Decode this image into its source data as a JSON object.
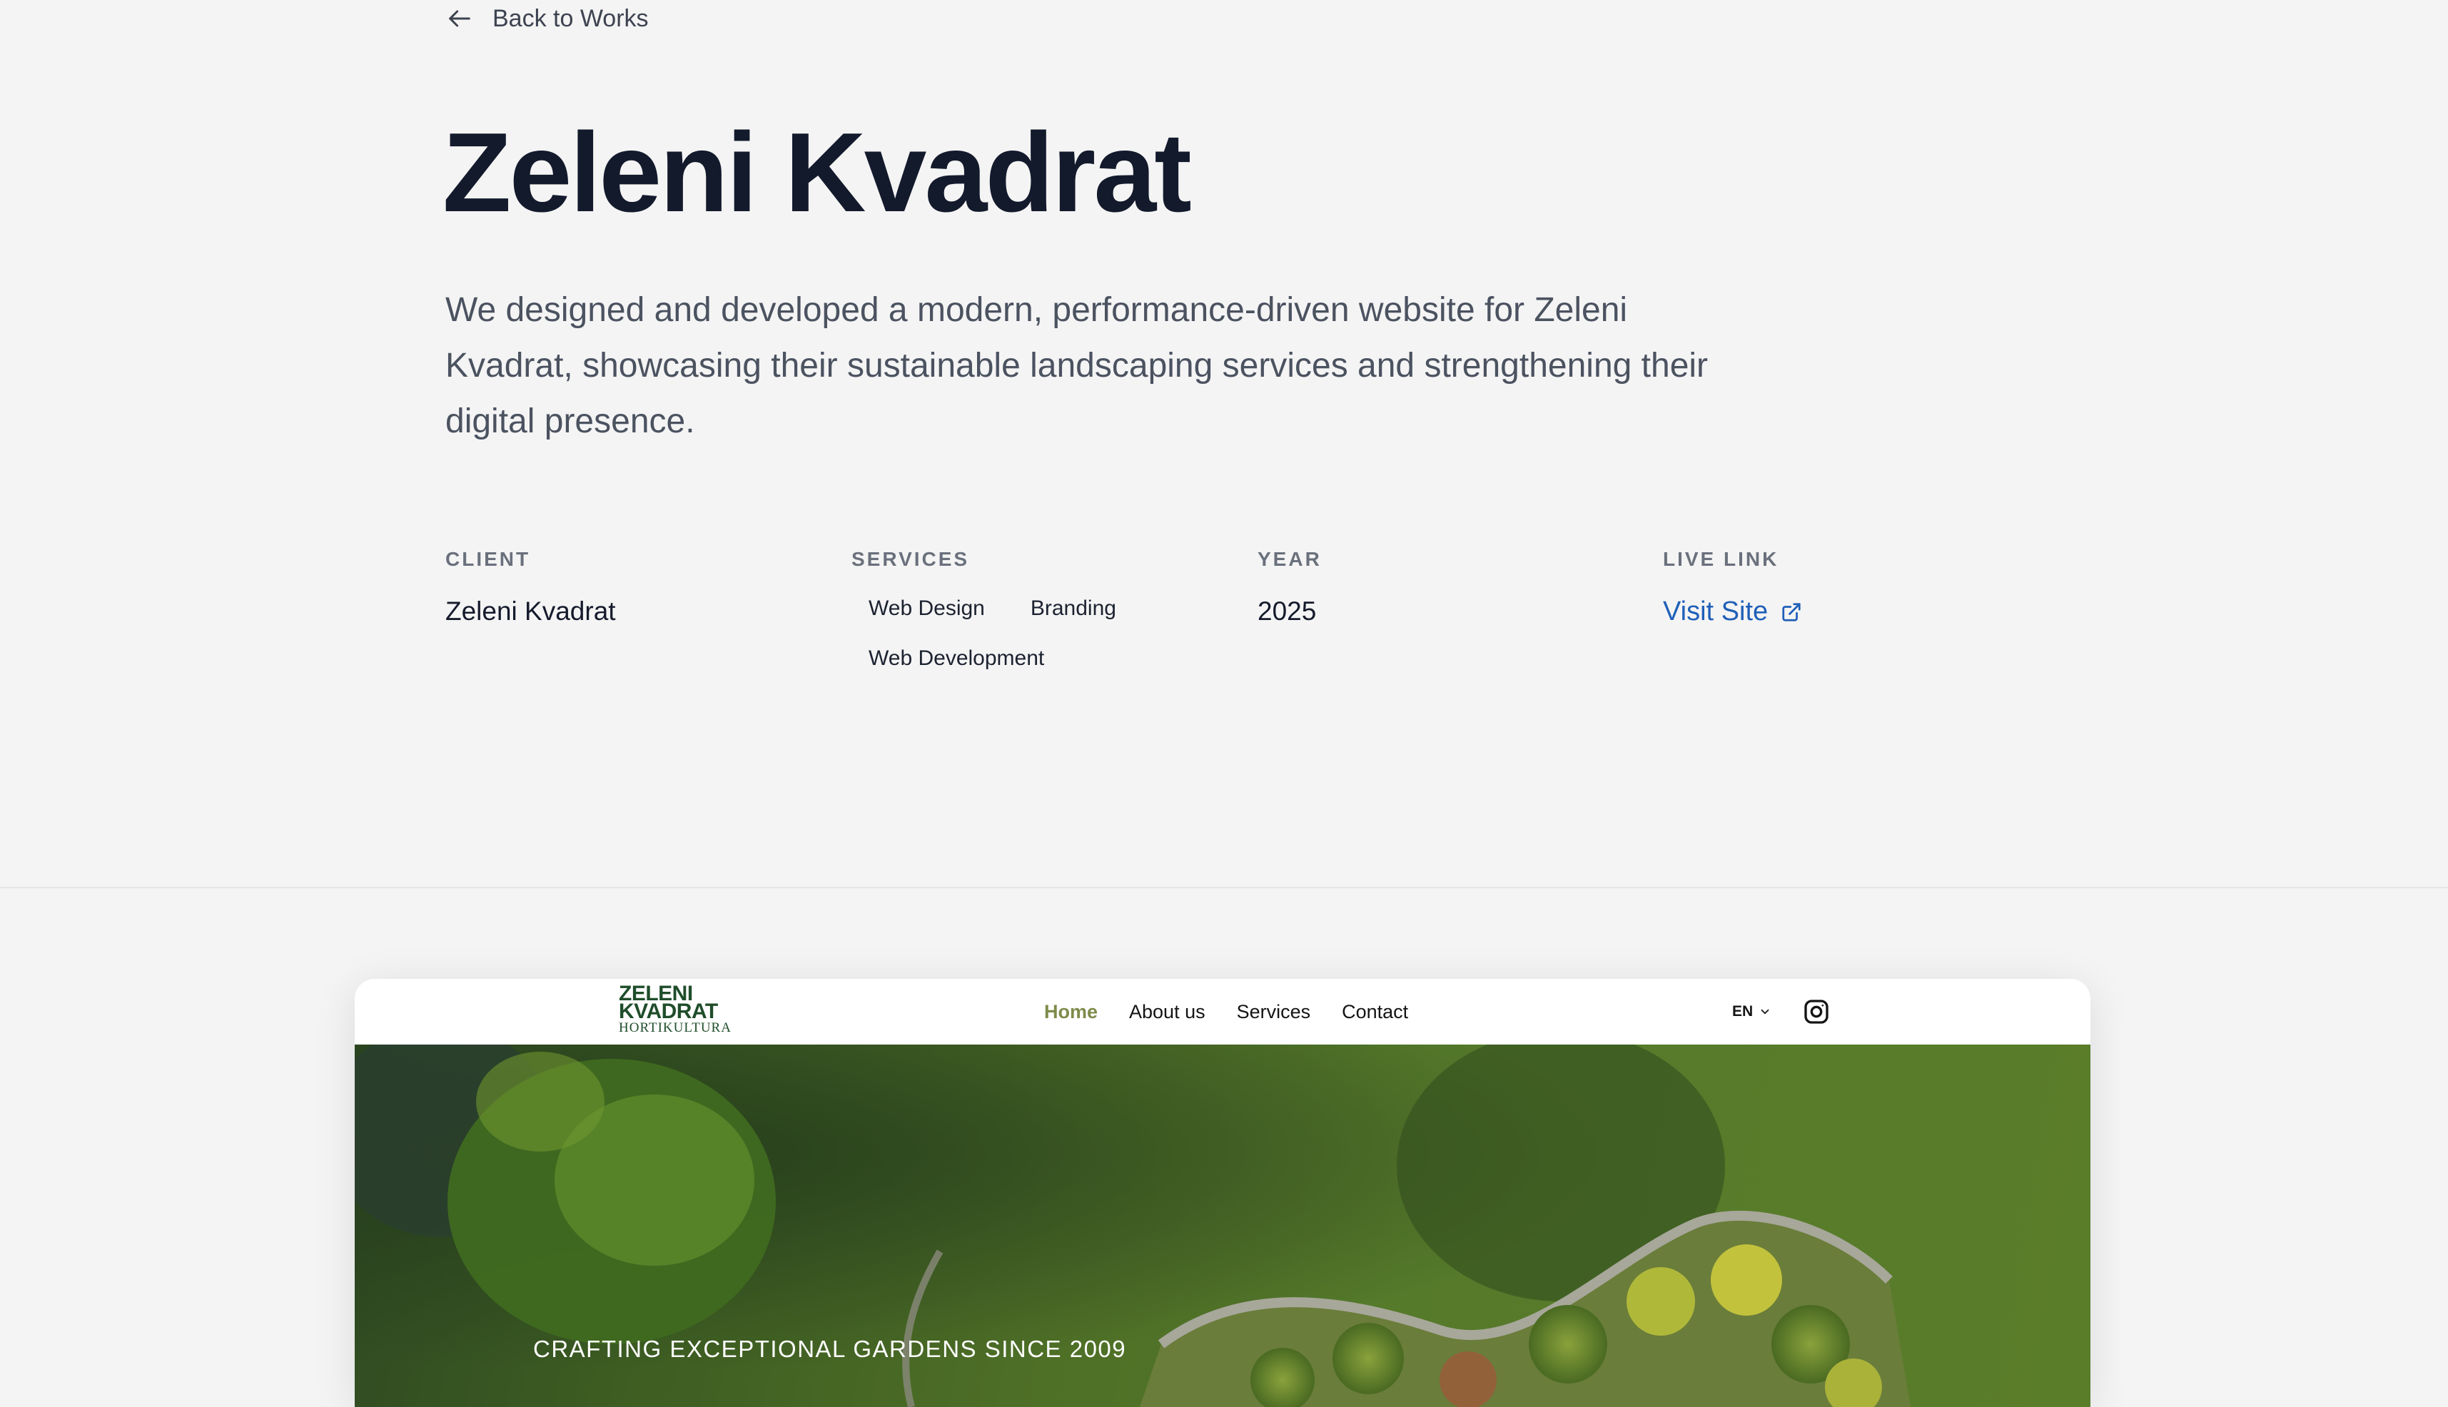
{
  "nav": {
    "back_label": "Back to Works"
  },
  "project": {
    "title": "Zeleni Kvadrat",
    "description": "We designed and developed a modern, performance-driven website for Zeleni Kvadrat, showcasing their sustainable landscaping services and strengthening their digital presence."
  },
  "meta": {
    "client": {
      "label": "CLIENT",
      "value": "Zeleni Kvadrat"
    },
    "services": {
      "label": "SERVICES",
      "items": [
        "Web Design",
        "Branding",
        "Web Development"
      ]
    },
    "year": {
      "label": "YEAR",
      "value": "2025"
    },
    "live_link": {
      "label": "LIVE LINK",
      "text": "Visit Site"
    }
  },
  "preview": {
    "logo": {
      "line1": "ZELENI",
      "line2": "KVADRAT",
      "sub": "HORTIKULTURA"
    },
    "nav_links": [
      "Home",
      "About us",
      "Services",
      "Contact"
    ],
    "active_link": "Home",
    "lang": "EN",
    "hero_tagline": "CRAFTING EXCEPTIONAL GARDENS SINCE 2009"
  },
  "colors": {
    "page_bg": "#f4f4f4",
    "title": "#131a2c",
    "link_blue": "#1f5fb8",
    "logo_green": "#1f4d2a",
    "nav_active": "#7d8b4a",
    "hero_green": "#4d6e26"
  },
  "icons": {
    "back": "arrow-left-icon",
    "external": "external-link-icon",
    "lang": "chevron-down-icon",
    "social": "instagram-icon"
  }
}
